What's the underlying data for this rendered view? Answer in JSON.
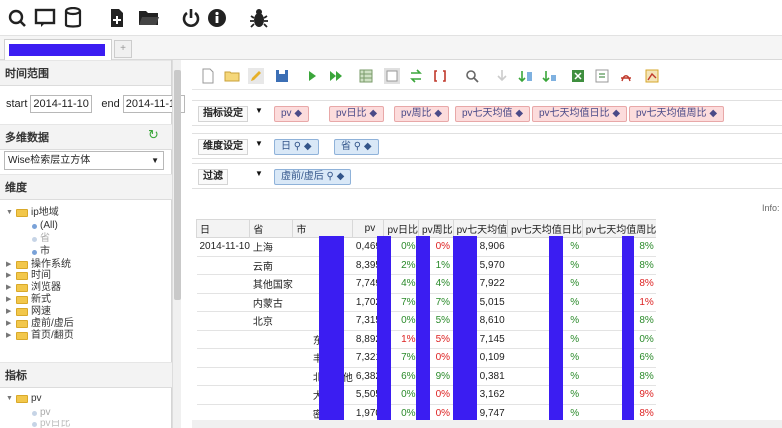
{
  "toolbar": {
    "icons": [
      "search-icon",
      "chat-icon",
      "database-icon",
      "new-file-icon",
      "open-folder-icon",
      "power-icon",
      "info-icon",
      "bug-icon"
    ]
  },
  "tabs": {
    "add_label": "+"
  },
  "left": {
    "time_range_title": "时间范围",
    "start_label": "start",
    "start_value": "2014-11-10",
    "end_label": "end",
    "end_value": "2014-11-16",
    "cube_title": "多维数据",
    "cube_selected": "Wise检索层立方体",
    "dimension_title": "维度",
    "tree": {
      "ip_label": "ip地域",
      "all_label": "(All)",
      "province_label": "省",
      "city_label": "市",
      "os_label": "操作系统",
      "time_label": "时间",
      "browser_label": "浏览器",
      "style_label": "新式",
      "speed_label": "网速",
      "prepost_label": "虚前/虚后",
      "homepage_label": "首页/翻页"
    },
    "metric_title": "指标",
    "metric_tree": {
      "pv_label": "pv",
      "pv_sub": "pv",
      "pv_rate": "pv日比"
    }
  },
  "filters": {
    "metric_label": "指标设定",
    "metric_chips": [
      "pv ◆",
      "pv日比 ◆",
      "pv周比 ◆",
      "pv七天均值 ◆",
      "pv七天均值日比 ◆",
      "pv七天均值周比 ◆"
    ],
    "dim_label": "维度设定",
    "dim_chips": [
      "日 ⚲ ◆",
      "省 ⚲ ◆"
    ],
    "filter_label": "过滤",
    "filter_chips": [
      "虚前/虚后 ⚲ ◆"
    ]
  },
  "info_label": "Info:",
  "table": {
    "headers": [
      "日",
      "省",
      "市",
      "pv",
      "pv日比",
      "pv周比",
      "pv七天均值",
      "pv七天均值日比",
      "pv七天均值周比"
    ],
    "rows": [
      {
        "day": "2014-11-10",
        "prov": "上海",
        "city": "",
        "pv": "0,469",
        "day_rate": "0%",
        "week_rate": "0%",
        "avg": "8,906",
        "avg_day": "%",
        "avg_week": "8%",
        "dr_cls": "pos",
        "wr_cls": "neg",
        "aw_cls": "pos"
      },
      {
        "day": "",
        "prov": "云南",
        "city": "",
        "pv": "8,395",
        "day_rate": "2%",
        "week_rate": "1%",
        "avg": "5,970",
        "avg_day": "%",
        "avg_week": "8%",
        "dr_cls": "pos",
        "wr_cls": "pos",
        "aw_cls": "pos"
      },
      {
        "day": "",
        "prov": "其他国家",
        "city": "",
        "pv": "7,749",
        "day_rate": "4%",
        "week_rate": "4%",
        "avg": "7,922",
        "avg_day": "%",
        "avg_week": "8%",
        "dr_cls": "pos",
        "wr_cls": "pos",
        "aw_cls": "neg"
      },
      {
        "day": "",
        "prov": "内蒙古",
        "city": "",
        "pv": "1,702",
        "day_rate": "7%",
        "week_rate": "7%",
        "avg": "5,015",
        "avg_day": "%",
        "avg_week": "1%",
        "dr_cls": "pos",
        "wr_cls": "pos",
        "aw_cls": "neg"
      },
      {
        "day": "",
        "prov": "北京",
        "city": "",
        "pv": "7,315",
        "day_rate": "0%",
        "week_rate": "5%",
        "avg": "8,610",
        "avg_day": "%",
        "avg_week": "8%",
        "dr_cls": "pos",
        "wr_cls": "pos",
        "aw_cls": "pos"
      },
      {
        "day": "",
        "prov": "",
        "city": "东城",
        "pv": "8,892",
        "day_rate": "1%",
        "week_rate": "5%",
        "avg": "7,145",
        "avg_day": "%",
        "avg_week": "0%",
        "dr_cls": "neg",
        "wr_cls": "neg",
        "aw_cls": "pos"
      },
      {
        "day": "",
        "prov": "",
        "city": "丰台",
        "pv": "7,321",
        "day_rate": "7%",
        "week_rate": "0%",
        "avg": "0,109",
        "avg_day": "%",
        "avg_week": "6%",
        "dr_cls": "pos",
        "wr_cls": "neg",
        "aw_cls": "pos"
      },
      {
        "day": "",
        "prov": "",
        "city": "北京其他",
        "pv": "6,382",
        "day_rate": "6%",
        "week_rate": "9%",
        "avg": "0,381",
        "avg_day": "%",
        "avg_week": "8%",
        "dr_cls": "pos",
        "wr_cls": "pos",
        "aw_cls": "pos"
      },
      {
        "day": "",
        "prov": "",
        "city": "大兴",
        "pv": "5,505",
        "day_rate": "0%",
        "week_rate": "0%",
        "avg": "3,162",
        "avg_day": "%",
        "avg_week": "9%",
        "dr_cls": "pos",
        "wr_cls": "neg",
        "aw_cls": "neg"
      },
      {
        "day": "",
        "prov": "",
        "city": "密云",
        "pv": "1,970",
        "day_rate": "0%",
        "week_rate": "0%",
        "avg": "9,747",
        "avg_day": "%",
        "avg_week": "8%",
        "dr_cls": "pos",
        "wr_cls": "neg",
        "aw_cls": "neg"
      }
    ]
  },
  "colors": {
    "redaction": "#3b1df2",
    "positive": "#2a8a2a",
    "negative": "#dd2222"
  }
}
